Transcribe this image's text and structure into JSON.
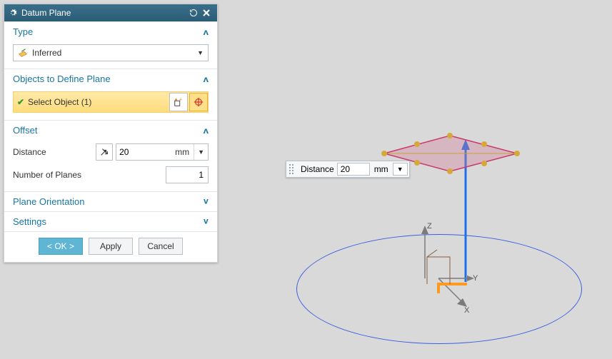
{
  "dialog": {
    "title": "Datum Plane",
    "sections": {
      "type": {
        "header": "Type",
        "expanded": true,
        "dropdown_value": "Inferred"
      },
      "objects": {
        "header": "Objects to Define Plane",
        "expanded": true,
        "select_label": "Select Object (1)"
      },
      "offset": {
        "header": "Offset",
        "expanded": true,
        "distance_label": "Distance",
        "distance_value": "20",
        "distance_unit": "mm",
        "count_label": "Number of Planes",
        "count_value": "1"
      },
      "orientation": {
        "header": "Plane Orientation",
        "expanded": false
      },
      "settings": {
        "header": "Settings",
        "expanded": false
      }
    },
    "buttons": {
      "ok": "< OK >",
      "apply": "Apply",
      "cancel": "Cancel"
    }
  },
  "overlay": {
    "label": "Distance",
    "value": "20",
    "unit": "mm"
  },
  "axes": {
    "x": "X",
    "y": "Y",
    "z": "Z"
  }
}
